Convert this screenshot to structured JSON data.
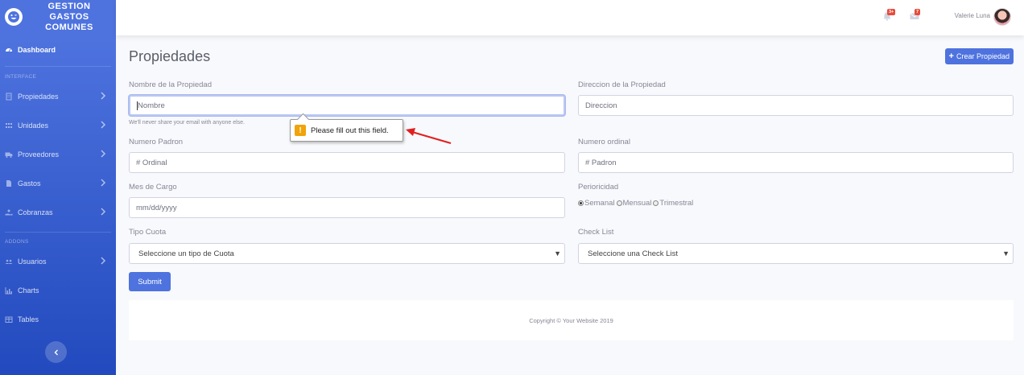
{
  "brand": {
    "line1": "GESTION",
    "line2": "GASTOS",
    "line3": "COMUNES",
    "icon": "laugh-wink-icon"
  },
  "sidebar": {
    "dashboard": "Dashboard",
    "heading_interface": "INTERFACE",
    "items_interface": [
      {
        "label": "Propiedades",
        "icon": "building-icon"
      },
      {
        "label": "Unidades",
        "icon": "grid-icon"
      },
      {
        "label": "Proveedores",
        "icon": "truck-icon"
      },
      {
        "label": "Gastos",
        "icon": "file-icon"
      },
      {
        "label": "Cobranzas",
        "icon": "hand-coin-icon"
      }
    ],
    "heading_addons": "ADDONS",
    "items_addons": [
      {
        "label": "Usuarios",
        "icon": "users-icon"
      },
      {
        "label": "Charts",
        "icon": "chart-icon"
      },
      {
        "label": "Tables",
        "icon": "table-icon"
      }
    ]
  },
  "topbar": {
    "alerts_badge": "3+",
    "messages_badge": "7",
    "user_name": "Valerie Luna"
  },
  "page": {
    "title": "Propiedades",
    "create_button": "Crear Propiedad"
  },
  "form": {
    "nombre_label": "Nombre de la Propiedad",
    "nombre_placeholder": "Nombre",
    "nombre_help": "We'll never share your email with anyone else.",
    "direccion_label": "Direccion de la Propiedad",
    "direccion_placeholder": "Direccion",
    "padron_label": "Numero Padron",
    "padron_placeholder": "# Ordinal",
    "ordinal_label": "Numero ordinal",
    "ordinal_placeholder": "# Padron",
    "mes_label": "Mes de Cargo",
    "mes_placeholder": "mm/dd/yyyy",
    "periodicidad_label": "Perioricidad",
    "periodicidad_options": [
      "Semanal",
      "Mensual",
      "Trimestral"
    ],
    "periodicidad_selected": "Semanal",
    "cuota_label": "Tipo Cuota",
    "cuota_value": "Seleccione un tipo de Cuota",
    "checklist_label": "Check List",
    "checklist_value": "Seleccione una Check List",
    "submit": "Submit"
  },
  "tooltip": {
    "text": "Please fill out this field.",
    "icon": "warning-icon"
  },
  "annotation": {
    "arrow_color": "#e02020"
  },
  "footer": {
    "copyright": "Copyright © Your Website 2019"
  },
  "colors": {
    "primary": "#4e73df",
    "danger": "#e74a3b",
    "warning": "#f0a30a"
  }
}
